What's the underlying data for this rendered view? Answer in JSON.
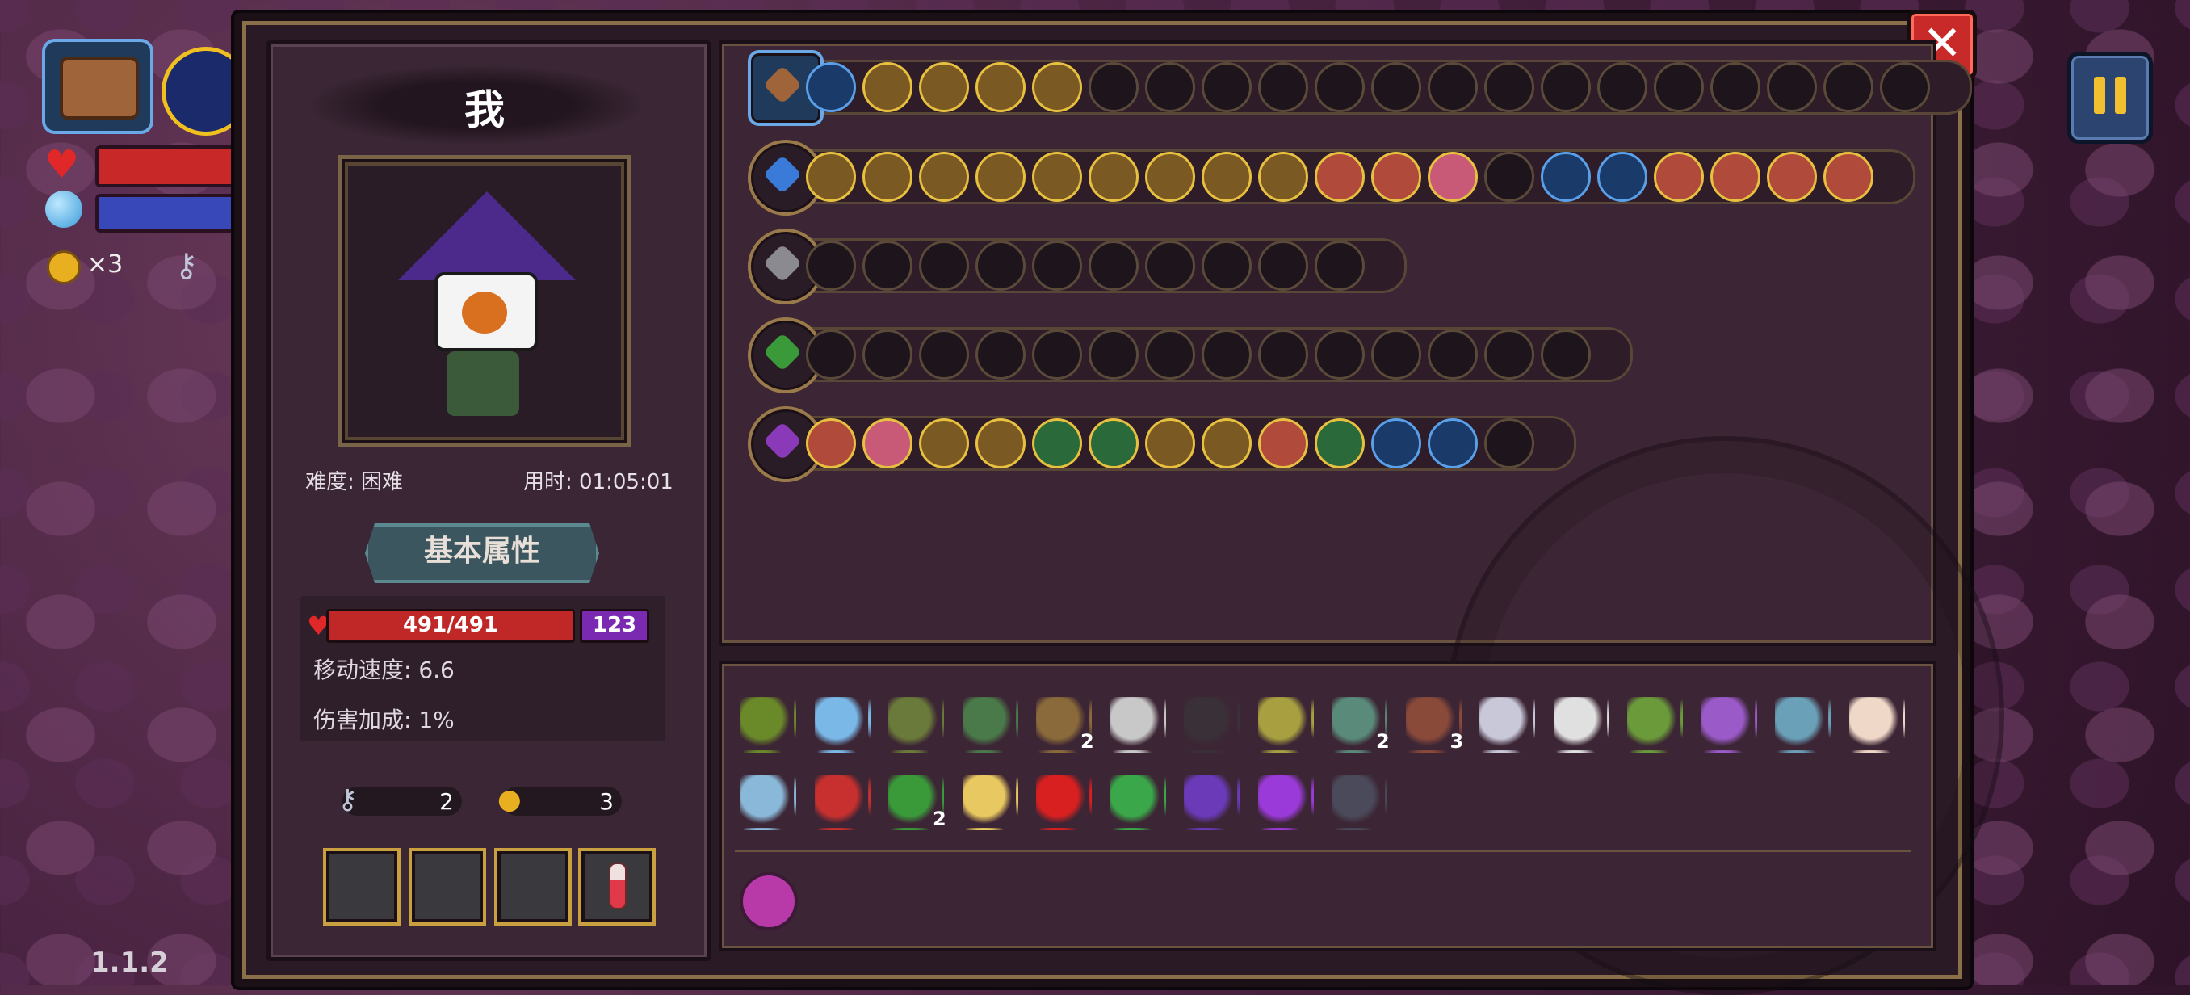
{
  "version": "1.1.2",
  "hud": {
    "coin_count": "×3",
    "colors": {
      "hp": "#c82828",
      "mp": "#3848b8"
    }
  },
  "character": {
    "name": "我",
    "difficulty": "难度: 困难",
    "time": "用时: 01:05:01",
    "basic_tab": "基本属性",
    "hp_value": "491/491",
    "hp_fraction": 1.0,
    "shield_value": "123",
    "move_speed": "移动速度: 6.6",
    "damage_bonus": "伤害加成: 1%",
    "keys": "2",
    "coins": "3"
  },
  "loadout_rows": [
    {
      "icon": "bag-icon",
      "slots": [
        "blue",
        "gold",
        "gold",
        "gold",
        "gold",
        "empty",
        "empty",
        "empty",
        "empty",
        "empty",
        "empty",
        "empty",
        "empty",
        "empty",
        "empty",
        "empty",
        "empty",
        "empty",
        "empty",
        "empty"
      ]
    },
    {
      "icon": "ice-sword-icon",
      "slots": [
        "gold",
        "gold",
        "gold",
        "gold",
        "gold",
        "gold",
        "gold",
        "gold",
        "gold",
        "red",
        "red",
        "pink",
        "empty",
        "blue",
        "blue",
        "red",
        "red",
        "red",
        "red"
      ]
    },
    {
      "icon": "cannon-icon",
      "slots": [
        "empty",
        "empty",
        "empty",
        "empty",
        "empty",
        "empty",
        "empty",
        "empty",
        "empty",
        "empty"
      ]
    },
    {
      "icon": "green-staff-icon",
      "slots": [
        "empty",
        "empty",
        "empty",
        "empty",
        "empty",
        "empty",
        "empty",
        "empty",
        "empty",
        "empty",
        "empty",
        "empty",
        "empty",
        "empty"
      ]
    },
    {
      "icon": "purple-staff-icon",
      "slots": [
        "red",
        "pink",
        "gold",
        "gold",
        "green",
        "green",
        "gold",
        "gold",
        "red",
        "green",
        "blue",
        "blue",
        "empty"
      ]
    }
  ],
  "items": [
    {
      "name": "antler-item",
      "color": "#6a8a2a",
      "count": ""
    },
    {
      "name": "crystal-item",
      "color": "#7ab8e8",
      "count": ""
    },
    {
      "name": "horn-item",
      "color": "#6a7a3a",
      "count": ""
    },
    {
      "name": "boot-item",
      "color": "#4a7a4a",
      "count": ""
    },
    {
      "name": "pickaxe-item",
      "color": "#8a6a3a",
      "count": "2"
    },
    {
      "name": "glasses-item",
      "color": "#c8c8c8",
      "count": ""
    },
    {
      "name": "bat-item",
      "color": "#3a3038",
      "count": ""
    },
    {
      "name": "claw-item",
      "color": "#a8a040",
      "count": ""
    },
    {
      "name": "dice-item",
      "color": "#5a8a7a",
      "count": "2"
    },
    {
      "name": "scroll-item",
      "color": "#8a4a3a",
      "count": "3"
    },
    {
      "name": "grapple-item",
      "color": "#c8c8d8",
      "count": ""
    },
    {
      "name": "skeleton-item",
      "color": "#e0e0e0",
      "count": ""
    },
    {
      "name": "goblin-item",
      "color": "#6a9a3a",
      "count": ""
    },
    {
      "name": "prism-item",
      "color": "#9a5ac8",
      "count": ""
    },
    {
      "name": "compass-item",
      "color": "#6aa0b8",
      "count": ""
    },
    {
      "name": "feather-item",
      "color": "#f0d8c8",
      "count": ""
    },
    {
      "name": "magnifier-item",
      "color": "#8ab8d8",
      "count": ""
    },
    {
      "name": "demon-mask-item",
      "color": "#c83030",
      "count": ""
    },
    {
      "name": "green-hand-item",
      "color": "#3a9a3a",
      "count": "2"
    },
    {
      "name": "cone-item",
      "color": "#e8c860",
      "count": ""
    },
    {
      "name": "red-eye-item",
      "color": "#d82020",
      "count": ""
    },
    {
      "name": "clover-item",
      "color": "#3aa84a",
      "count": ""
    },
    {
      "name": "witch-hat-item",
      "color": "#6a3ab8",
      "count": ""
    },
    {
      "name": "purple-boot-item",
      "color": "#9a3ad8",
      "count": ""
    },
    {
      "name": "cloak-item",
      "color": "#4a4a5a",
      "count": ""
    }
  ]
}
